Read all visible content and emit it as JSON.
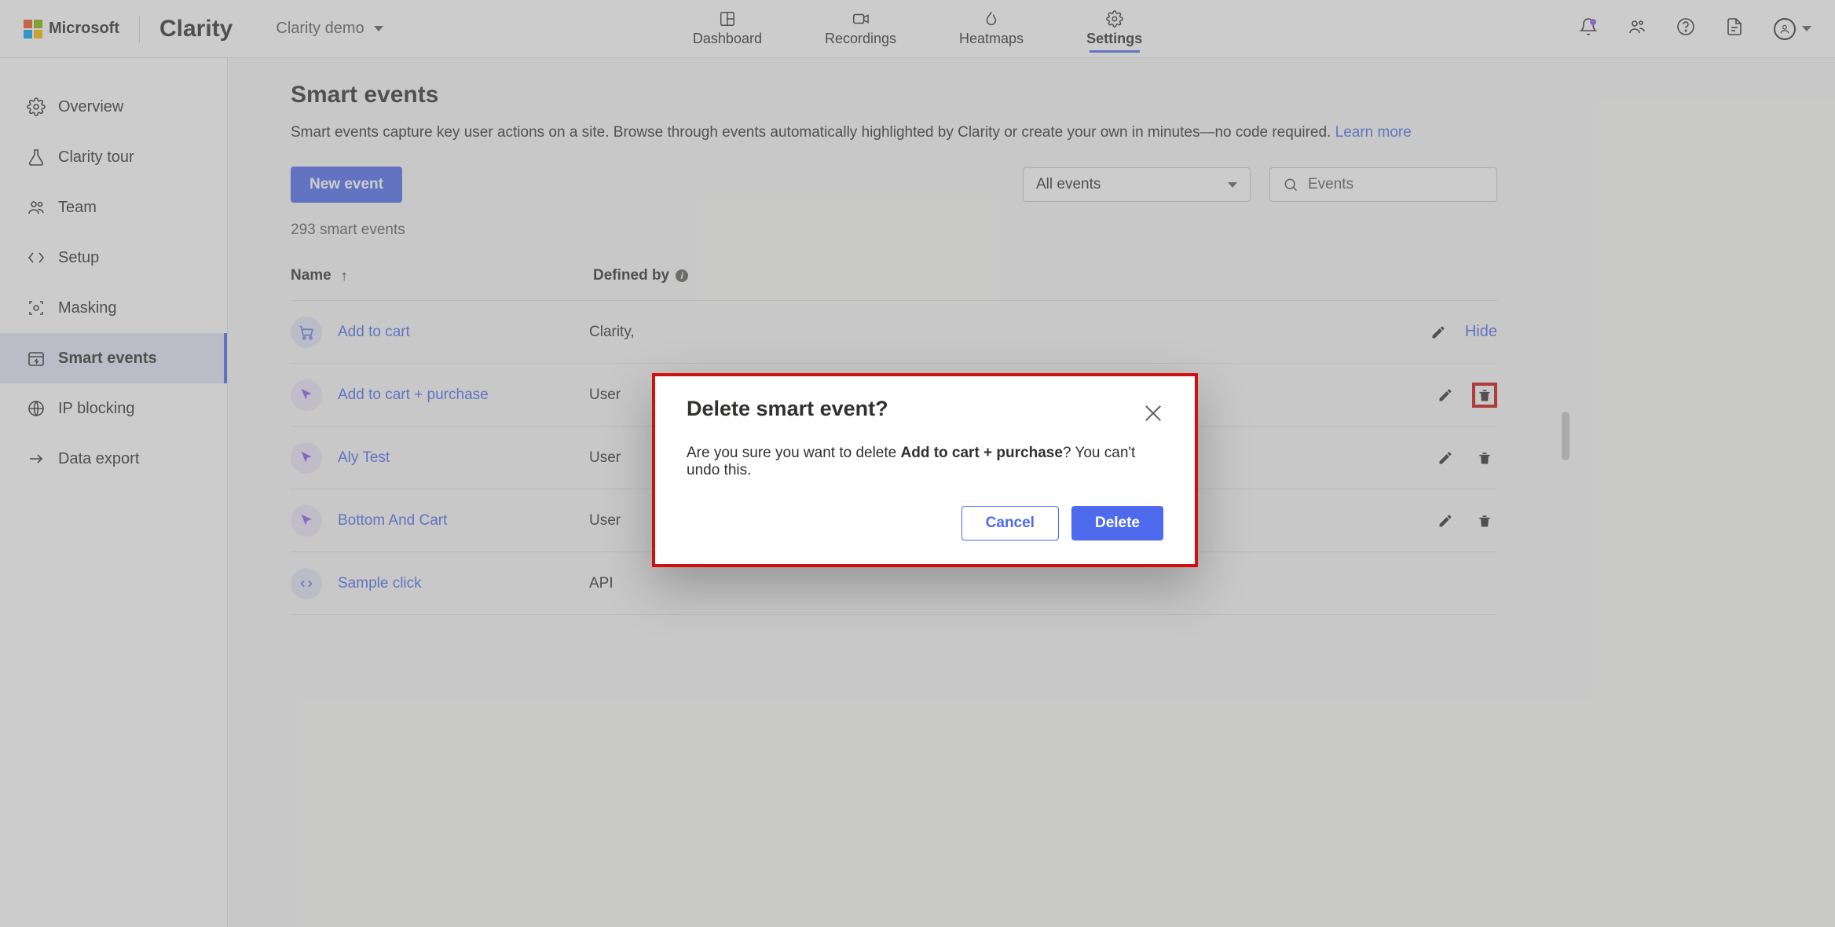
{
  "header": {
    "ms_label": "Microsoft",
    "app_name": "Clarity",
    "project": "Clarity demo",
    "tabs": [
      {
        "label": "Dashboard"
      },
      {
        "label": "Recordings"
      },
      {
        "label": "Heatmaps"
      },
      {
        "label": "Settings"
      }
    ]
  },
  "sidebar": {
    "items": [
      {
        "label": "Overview"
      },
      {
        "label": "Clarity tour"
      },
      {
        "label": "Team"
      },
      {
        "label": "Setup"
      },
      {
        "label": "Masking"
      },
      {
        "label": "Smart events"
      },
      {
        "label": "IP blocking"
      },
      {
        "label": "Data export"
      }
    ]
  },
  "page": {
    "title": "Smart events",
    "description": "Smart events capture key user actions on a site. Browse through events automatically highlighted by Clarity or create your own in minutes—no code required. ",
    "learn_more": "Learn more",
    "new_event": "New event",
    "filter_value": "All events",
    "search_placeholder": "Events",
    "count": "293 smart events",
    "col_name": "Name",
    "col_defined": "Defined by",
    "hide_label": "Hide"
  },
  "events": [
    {
      "name": "Add to cart",
      "defined": "Clarity,",
      "icon": "cart"
    },
    {
      "name": "Add to cart + purchase",
      "defined": "User",
      "icon": "pointer"
    },
    {
      "name": "Aly Test",
      "defined": "User",
      "icon": "pointer"
    },
    {
      "name": "Bottom And Cart",
      "defined": "User",
      "icon": "pointer"
    },
    {
      "name": "Sample click",
      "defined": "API",
      "icon": "code"
    }
  ],
  "modal": {
    "title": "Delete smart event?",
    "body_prefix": "Are you sure you want to delete ",
    "body_bold": "Add to cart + purchase",
    "body_suffix": "? You can't undo this.",
    "cancel": "Cancel",
    "delete": "Delete"
  }
}
